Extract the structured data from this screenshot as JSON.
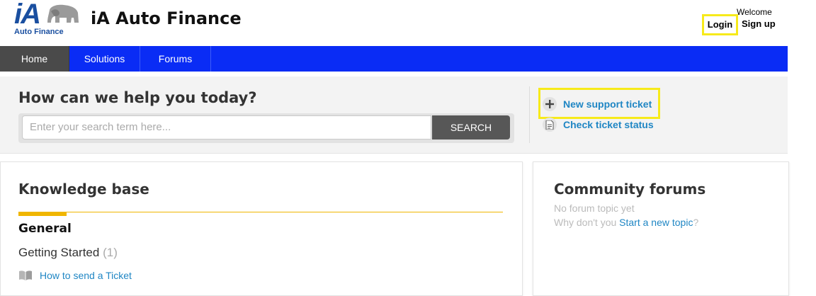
{
  "header": {
    "logo_mark": "iA",
    "logo_sub": "Auto Finance",
    "site_title": "iA Auto Finance",
    "welcome": "Welcome",
    "login": "Login",
    "signup": "Sign up",
    "highlight_color": "#f7ea1a"
  },
  "nav": {
    "color": "#0a2cf5",
    "items": [
      {
        "label": "Home",
        "active": true
      },
      {
        "label": "Solutions",
        "active": false
      },
      {
        "label": "Forums",
        "active": false
      }
    ]
  },
  "help": {
    "title": "How can we help you today?",
    "search_placeholder": "Enter your search term here...",
    "search_button": "SEARCH",
    "links": [
      {
        "label": "New support ticket",
        "icon": "plus-icon"
      },
      {
        "label": "Check ticket status",
        "icon": "document-icon"
      }
    ]
  },
  "knowledge_base": {
    "title": "Knowledge base",
    "category": "General",
    "folder": "Getting Started",
    "folder_count": "(1)",
    "article": "How to send a Ticket",
    "accent_color": "#f0b600"
  },
  "community": {
    "title": "Community forums",
    "empty_text": "No forum topic yet",
    "prompt_prefix": "Why don't you",
    "prompt_link": "Start a new topic",
    "prompt_suffix": "?"
  }
}
